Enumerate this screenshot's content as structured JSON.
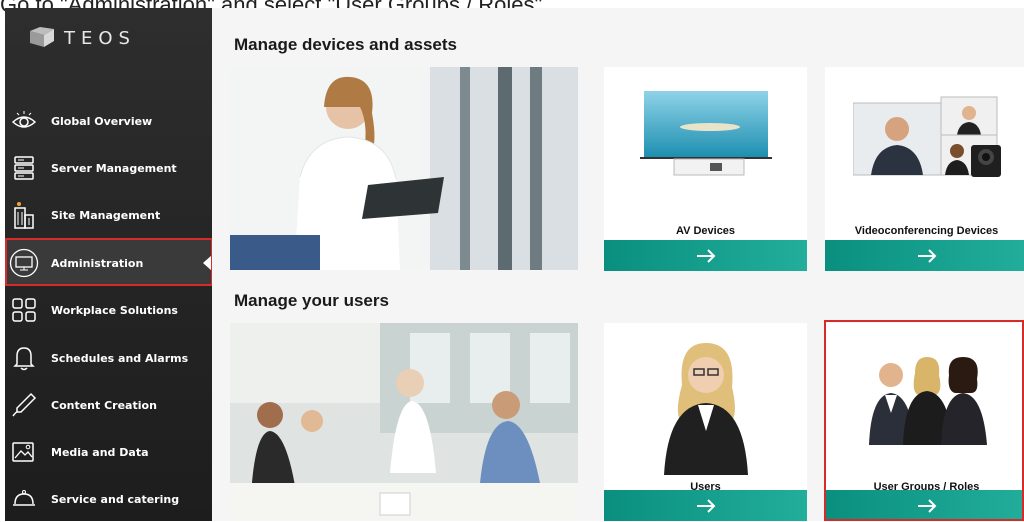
{
  "instruction": "Go to \"Administration\" and select \"User Groups / Roles\".",
  "brand": {
    "name": "TEOS"
  },
  "sidebar": {
    "items": [
      {
        "label": "Global Overview",
        "icon": "eye-icon"
      },
      {
        "label": "Server Management",
        "icon": "server-icon"
      },
      {
        "label": "Site Management",
        "icon": "building-icon"
      },
      {
        "label": "Administration",
        "icon": "monitor-icon",
        "active": true
      },
      {
        "label": "Workplace Solutions",
        "icon": "grid-icon"
      },
      {
        "label": "Schedules and Alarms",
        "icon": "bell-icon"
      },
      {
        "label": "Content Creation",
        "icon": "pen-icon"
      },
      {
        "label": "Media and Data",
        "icon": "image-icon"
      },
      {
        "label": "Service and catering",
        "icon": "cloche-icon"
      }
    ]
  },
  "main": {
    "sections": [
      {
        "title": "Manage devices and assets",
        "cards": [
          {
            "label": "AV Devices"
          },
          {
            "label": "Videoconferencing Devices"
          }
        ]
      },
      {
        "title": "Manage your users",
        "cards": [
          {
            "label": "Users"
          },
          {
            "label": "User Groups / Roles"
          }
        ]
      }
    ],
    "arrow": "→"
  },
  "colors": {
    "highlight": "#d62b2b",
    "button_start": "#0a8f7e",
    "button_end": "#22ae9b",
    "sidebar_bg": "#262626"
  }
}
